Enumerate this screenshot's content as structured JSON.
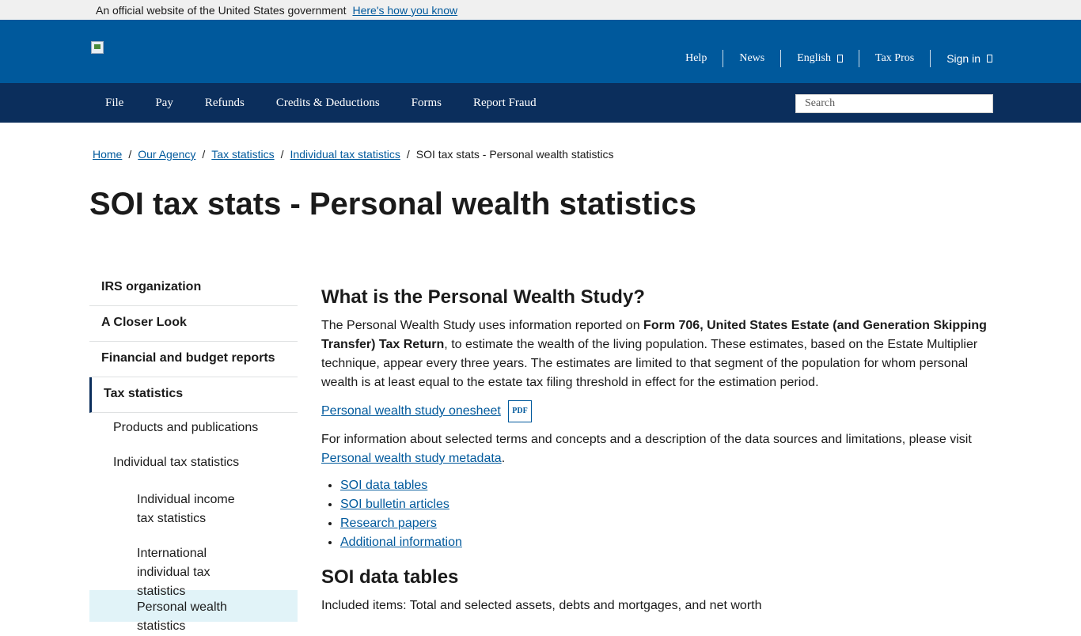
{
  "gov_banner": {
    "text": "An official website of the United States government",
    "link": "Here's how you know"
  },
  "utility_nav": {
    "items": [
      "Help",
      "News",
      "English",
      "Tax Pros",
      "Sign in"
    ]
  },
  "main_nav": {
    "items": [
      "File",
      "Pay",
      "Refunds",
      "Credits & Deductions",
      "Forms",
      "Report Fraud"
    ],
    "search_placeholder": "Search"
  },
  "breadcrumb": {
    "links": [
      "Home",
      "Our Agency",
      "Tax statistics",
      "Individual tax statistics"
    ],
    "current": "SOI tax stats - Personal wealth statistics"
  },
  "page_title": "SOI tax stats - Personal wealth statistics",
  "sidebar": {
    "items": [
      {
        "label": "IRS organization"
      },
      {
        "label": "A Closer Look"
      },
      {
        "label": "Financial and budget reports"
      },
      {
        "label": "Tax statistics"
      },
      {
        "label": "Products and publications"
      },
      {
        "label": "Individual tax statistics"
      },
      {
        "label": "Individual income tax statistics"
      },
      {
        "label": "International individual tax statistics"
      },
      {
        "label": "Personal wealth statistics"
      }
    ]
  },
  "content": {
    "heading1": "What is the Personal Wealth Study?",
    "p1_before": "The Personal Wealth Study uses information reported on ",
    "p1_bold": "Form 706, United States Estate (and Generation Skipping Transfer) Tax Return",
    "p1_after": ", to estimate the wealth of the living population. These estimates, based on the Estate Multiplier technique, appear every three years. The estimates are limited to that segment of the population for whom personal wealth is at least equal to the estate tax filing threshold in effect for the estimation period.",
    "onesheet_link": "Personal wealth study onesheet",
    "pdf_badge": "PDF",
    "p2": "For information about selected terms and concepts and a description of the data sources and limitations, please visit",
    "metadata_link": "Personal wealth study metadata",
    "list": [
      "SOI data tables",
      "SOI bulletin articles",
      "Research papers",
      "Additional information"
    ],
    "heading2": "SOI data tables",
    "p3": "Included items: Total and selected assets, debts and mortgages, and net worth"
  }
}
